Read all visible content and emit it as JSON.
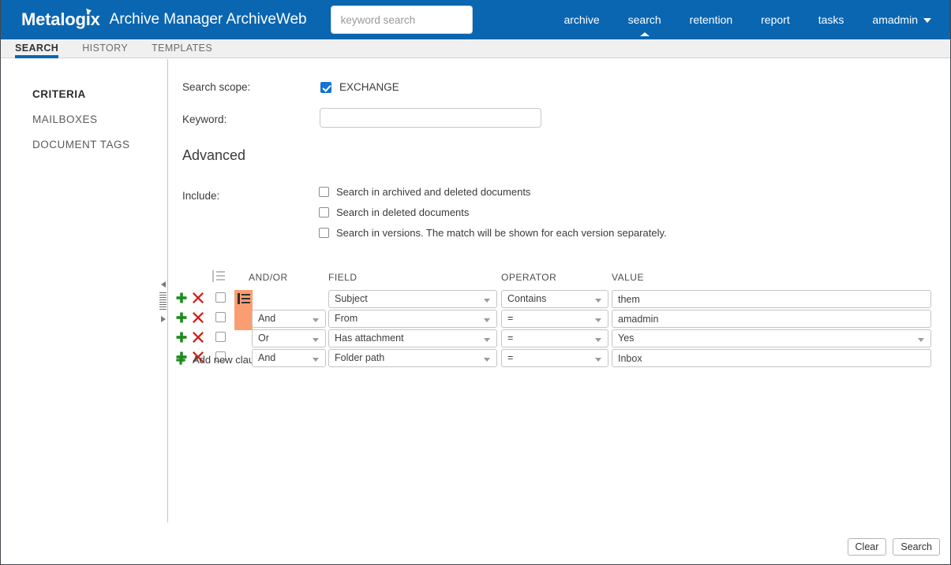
{
  "header": {
    "brand": "Metalogix",
    "app_title": "Archive Manager ArchiveWeb",
    "search_placeholder": "keyword search",
    "search_value": "",
    "nav": [
      {
        "label": "archive",
        "active": false
      },
      {
        "label": "search",
        "active": true
      },
      {
        "label": "retention",
        "active": false
      },
      {
        "label": "report",
        "active": false
      },
      {
        "label": "tasks",
        "active": false
      }
    ],
    "user": "amadmin",
    "accent_color": "#0a66b1"
  },
  "tabs": [
    {
      "label": "SEARCH",
      "active": true
    },
    {
      "label": "HISTORY",
      "active": false
    },
    {
      "label": "TEMPLATES",
      "active": false
    }
  ],
  "sidebar": {
    "items": [
      {
        "label": "CRITERIA",
        "active": true
      },
      {
        "label": "MAILBOXES",
        "active": false
      },
      {
        "label": "DOCUMENT TAGS",
        "active": false
      }
    ]
  },
  "form": {
    "scope_label": "Search scope:",
    "scope_option": "EXCHANGE",
    "scope_checked": true,
    "keyword_label": "Keyword:",
    "keyword_value": "",
    "advanced_title": "Advanced",
    "include_label": "Include:",
    "include_options": [
      {
        "label": "Search in archived and deleted documents",
        "checked": false
      },
      {
        "label": "Search in deleted documents",
        "checked": false
      },
      {
        "label": "Search in versions. The match will be shown for each version separately.",
        "checked": false
      }
    ]
  },
  "criteria": {
    "columns": {
      "andor": "AND/OR",
      "field": "FIELD",
      "operator": "OPERATOR",
      "value": "VALUE"
    },
    "group_highlight_color": "#fa9e72",
    "rows": [
      {
        "andor": "",
        "has_andor": false,
        "field": "Subject",
        "operator": "Contains",
        "value": "them",
        "value_is_select": false,
        "selected": false
      },
      {
        "andor": "And",
        "has_andor": true,
        "field": "From",
        "operator": "=",
        "value": "amadmin",
        "value_is_select": false,
        "selected": false
      },
      {
        "andor": "Or",
        "has_andor": true,
        "field": "Has attachment",
        "operator": "=",
        "value": "Yes",
        "value_is_select": true,
        "selected": false
      },
      {
        "andor": "And",
        "has_andor": true,
        "field": "Folder path",
        "operator": "=",
        "value": "Inbox",
        "value_is_select": false,
        "selected": false
      }
    ],
    "add_clause_label": "Add new clause"
  },
  "footer": {
    "clear_label": "Clear",
    "search_label": "Search"
  }
}
